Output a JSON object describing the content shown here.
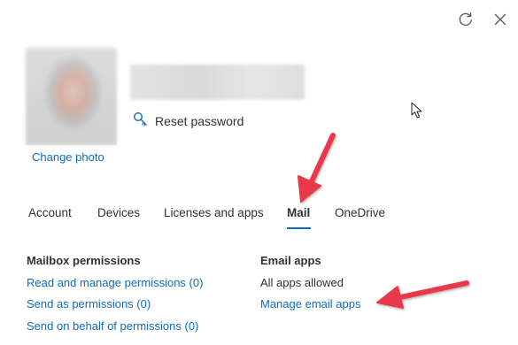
{
  "header": {
    "refresh_icon": "refresh-icon",
    "close_icon": "close-icon"
  },
  "profile": {
    "change_photo_label": "Change photo",
    "reset_password_label": "Reset password",
    "reset_icon": "key-icon"
  },
  "tabs": [
    {
      "label": "Account",
      "active": false
    },
    {
      "label": "Devices",
      "active": false
    },
    {
      "label": "Licenses and apps",
      "active": false
    },
    {
      "label": "Mail",
      "active": true
    },
    {
      "label": "OneDrive",
      "active": false
    }
  ],
  "mailbox_permissions": {
    "title": "Mailbox permissions",
    "links": [
      "Read and manage permissions (0)",
      "Send as permissions (0)",
      "Send on behalf of permissions (0)"
    ]
  },
  "email_apps": {
    "title": "Email apps",
    "status": "All apps allowed",
    "manage_link": "Manage email apps"
  },
  "colors": {
    "link": "#0f6cbd",
    "annotation_arrow": "#e8394a",
    "text": "#323130"
  }
}
